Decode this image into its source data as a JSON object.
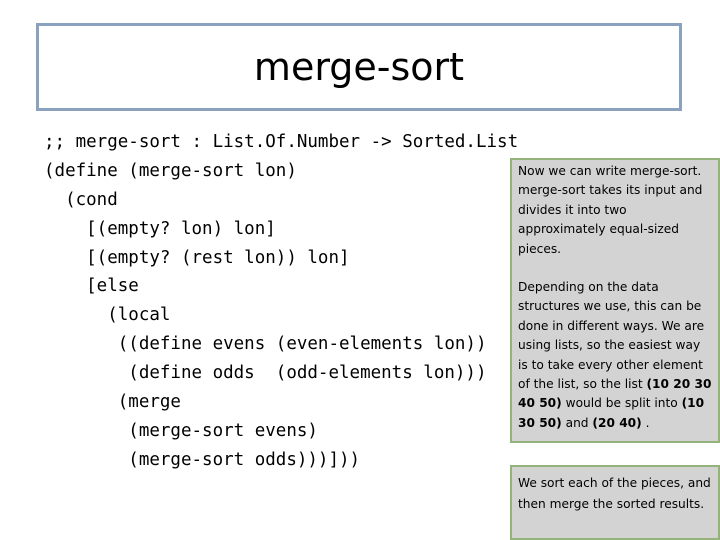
{
  "slide": {
    "title": "merge-sort"
  },
  "code": {
    "lines": [
      ";; merge-sort : List.Of.Number -> Sorted.List",
      "(define (merge-sort lon)",
      "  (cond",
      "    [(empty? lon) lon]",
      "    [(empty? (rest lon)) lon]",
      "    [else",
      "      (local",
      "       ((define evens (even-elements lon))",
      "        (define odds  (odd-elements lon)))",
      "       (merge",
      "        (merge-sort evens)",
      "        (merge-sort odds)))]))"
    ]
  },
  "notes": {
    "explanation": {
      "para1": "Now we can write merge-sort. merge-sort takes its input and divides it into two approximately equal-sized pieces.",
      "para2_a": "Depending on the data structures we use, this can be done in different ways.  We are using lists, so the easiest way is to take every other element of the list, so the list ",
      "para2_list": "(10 20 30 40 50)",
      "para2_b": " would be split into ",
      "para2_part1": "(10 30 50)",
      "para2_c": " and ",
      "para2_part2": "(20 40)",
      "para2_d": " ."
    },
    "summary": {
      "text": "We sort each of the pieces, and then merge the sorted results."
    }
  },
  "colors": {
    "title_border": "#8aa2bd",
    "note_border": "#94b37a",
    "note_background": "#d3d3d3"
  }
}
